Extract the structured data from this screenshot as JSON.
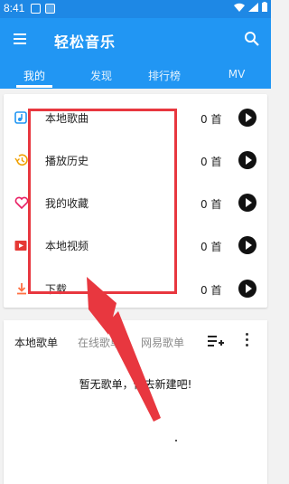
{
  "status": {
    "time": "8:41"
  },
  "appbar": {
    "title": "轻松音乐"
  },
  "tabs": [
    "我的",
    "发现",
    "排行榜",
    "MV"
  ],
  "local": [
    {
      "label": "本地歌曲",
      "count": "0 首",
      "icon": "music-note-icon",
      "color": "#2196f3"
    },
    {
      "label": "播放历史",
      "count": "0 首",
      "icon": "history-icon",
      "color": "#f0a000"
    },
    {
      "label": "我的收藏",
      "count": "0 首",
      "icon": "heart-icon",
      "color": "#e91e63"
    },
    {
      "label": "本地视频",
      "count": "0 首",
      "icon": "video-icon",
      "color": "#e53935"
    },
    {
      "label": "下载",
      "count": "0 首",
      "icon": "download-icon",
      "color": "#ff7043"
    }
  ],
  "playlists": {
    "tabs": [
      "本地歌单",
      "在线歌单",
      "网易歌单"
    ],
    "empty_text": "暂无歌单，快去新建吧!"
  },
  "colors": {
    "primary": "#2196f3",
    "highlight": "#e8373f"
  }
}
